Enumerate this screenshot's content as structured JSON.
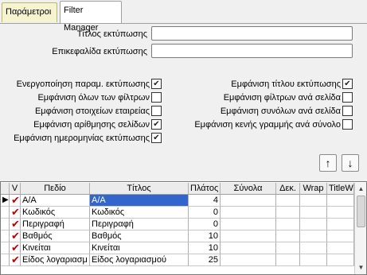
{
  "tabs": [
    {
      "label": "Παράμετροι"
    },
    {
      "label": "Filter Manager"
    }
  ],
  "form": {
    "print_title_label": "Τίτλος εκτύπωσης",
    "print_title_value": "",
    "print_header_label": "Επικεφαλίδα εκτύπωσης",
    "print_header_value": ""
  },
  "options_left": [
    {
      "label": "Ενεργοποίηση παραμ. εκτύπωσης",
      "checked": true
    },
    {
      "label": "Εμφάνιση όλων των φίλτρων",
      "checked": false
    },
    {
      "label": "Εμφάνιση στοιχείων εταιρείας",
      "checked": false
    },
    {
      "label": "Εμφάνιση αρίθμησης σελίδων",
      "checked": true
    },
    {
      "label": "Εμφάνιση ημερομηνίας εκτύπωσης",
      "checked": true
    }
  ],
  "options_right": [
    {
      "label": "Εμφάνιση τίτλου εκτύπωσης",
      "checked": true
    },
    {
      "label": "Εμφάνιση φίλτρων ανά σελίδα",
      "checked": false
    },
    {
      "label": "Εμφάνιση συνόλων ανά σελίδα",
      "checked": false
    },
    {
      "label": "Εμφάνιση κενής γραμμής ανά σύνολο",
      "checked": false
    }
  ],
  "grid": {
    "columns": [
      "V",
      "Πεδίο",
      "Τίτλος",
      "Πλάτος",
      "Σύνολα",
      "Δεκ.",
      "Wrap",
      "TitleW"
    ],
    "rows": [
      {
        "field": "Α/Α",
        "title": "Α/Α",
        "width": "4"
      },
      {
        "field": "Κωδικός",
        "title": "Κωδικός",
        "width": "0"
      },
      {
        "field": "Περιγραφή",
        "title": "Περιγραφή",
        "width": "0"
      },
      {
        "field": "Βαθμός",
        "title": "Βαθμός",
        "width": "10"
      },
      {
        "field": "Κινείται",
        "title": "Κινείται",
        "width": "10"
      },
      {
        "field": "Είδος λογαριασμ",
        "title": "Είδος λογαριασμού",
        "width": "25"
      }
    ]
  },
  "icons": {
    "up": "↑",
    "down": "↓",
    "check": "✔",
    "row_pointer": "▶",
    "scroll_up": "▲",
    "scroll_down": "▼"
  }
}
